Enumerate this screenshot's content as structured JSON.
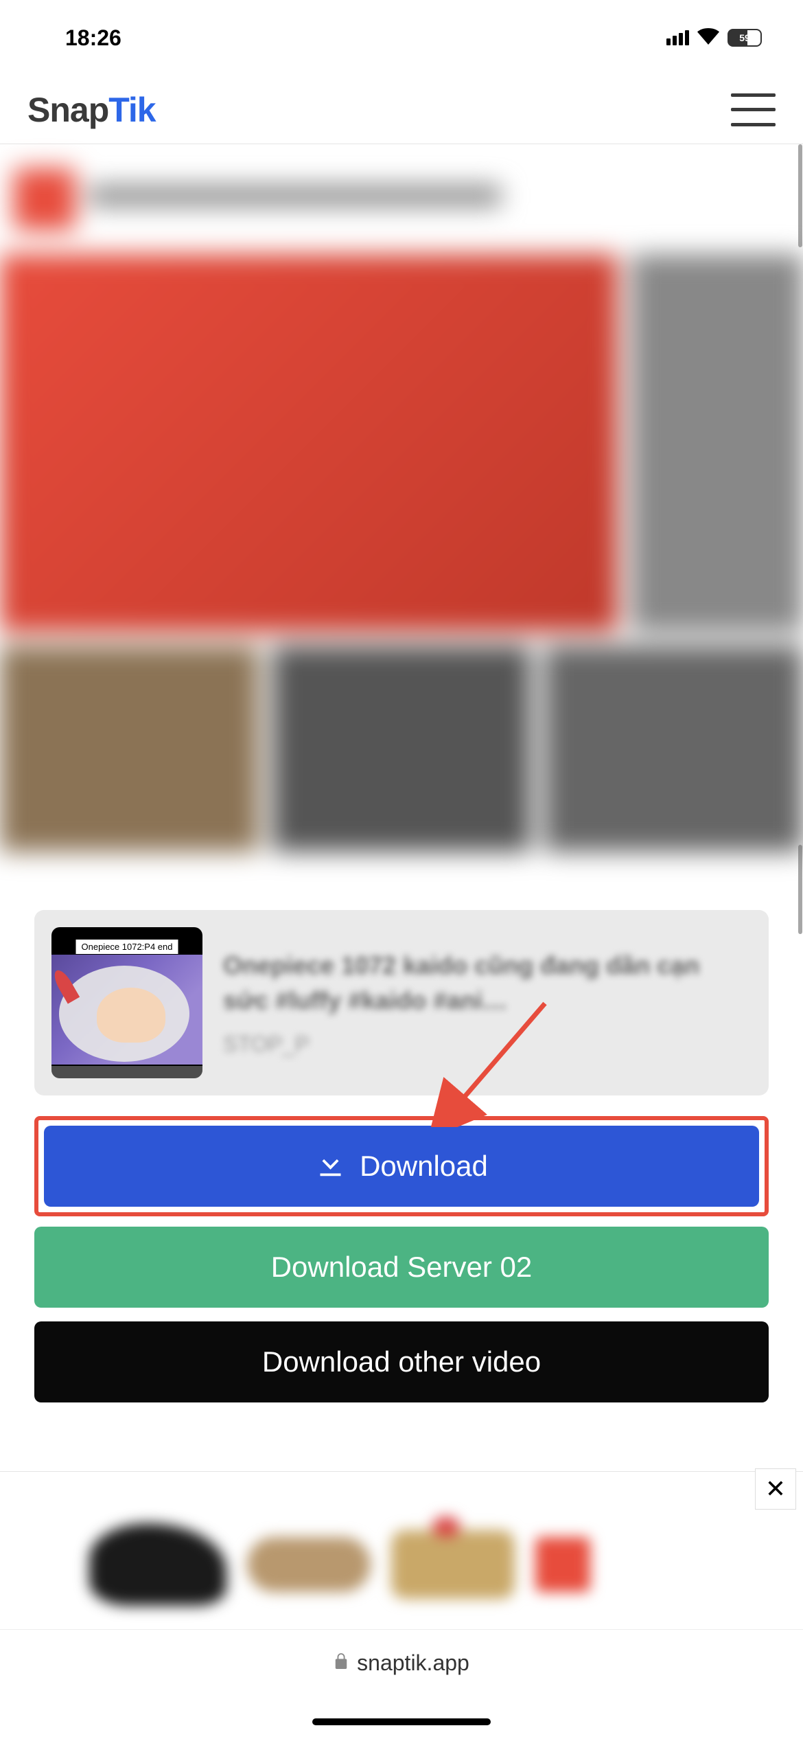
{
  "status_bar": {
    "time": "18:26",
    "battery_percent": "59"
  },
  "header": {
    "logo_part1": "Snap",
    "logo_part2": "Tik"
  },
  "video_card": {
    "thumb_caption": "Onepiece 1072:P4 end",
    "title": "Onepiece 1072 kaido cũng đang dần cạn sức #luffy #kaido #ani…",
    "author": "STOP_P"
  },
  "buttons": {
    "primary": "Download",
    "server02": "Download Server 02",
    "other": "Download other video"
  },
  "ad": {
    "close": "✕"
  },
  "browser": {
    "url": "snaptik.app"
  }
}
